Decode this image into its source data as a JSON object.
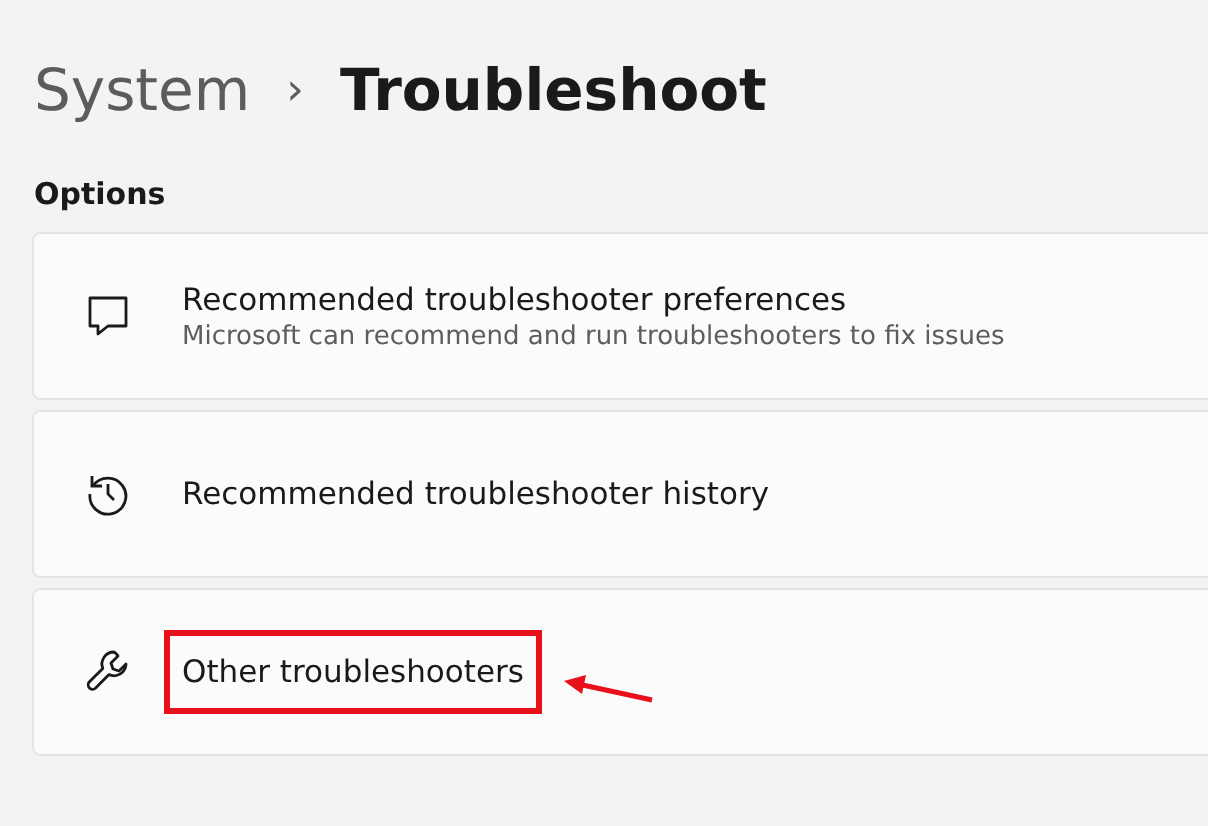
{
  "breadcrumb": {
    "parent": "System",
    "separator": "›",
    "current": "Troubleshoot"
  },
  "section_title": "Options",
  "items": [
    {
      "title": "Recommended troubleshooter preferences",
      "subtitle": "Microsoft can recommend and run troubleshooters to fix issues",
      "highlighted": false
    },
    {
      "title": "Recommended troubleshooter history",
      "highlighted": false
    },
    {
      "title": "Other troubleshooters",
      "highlighted": true
    }
  ]
}
